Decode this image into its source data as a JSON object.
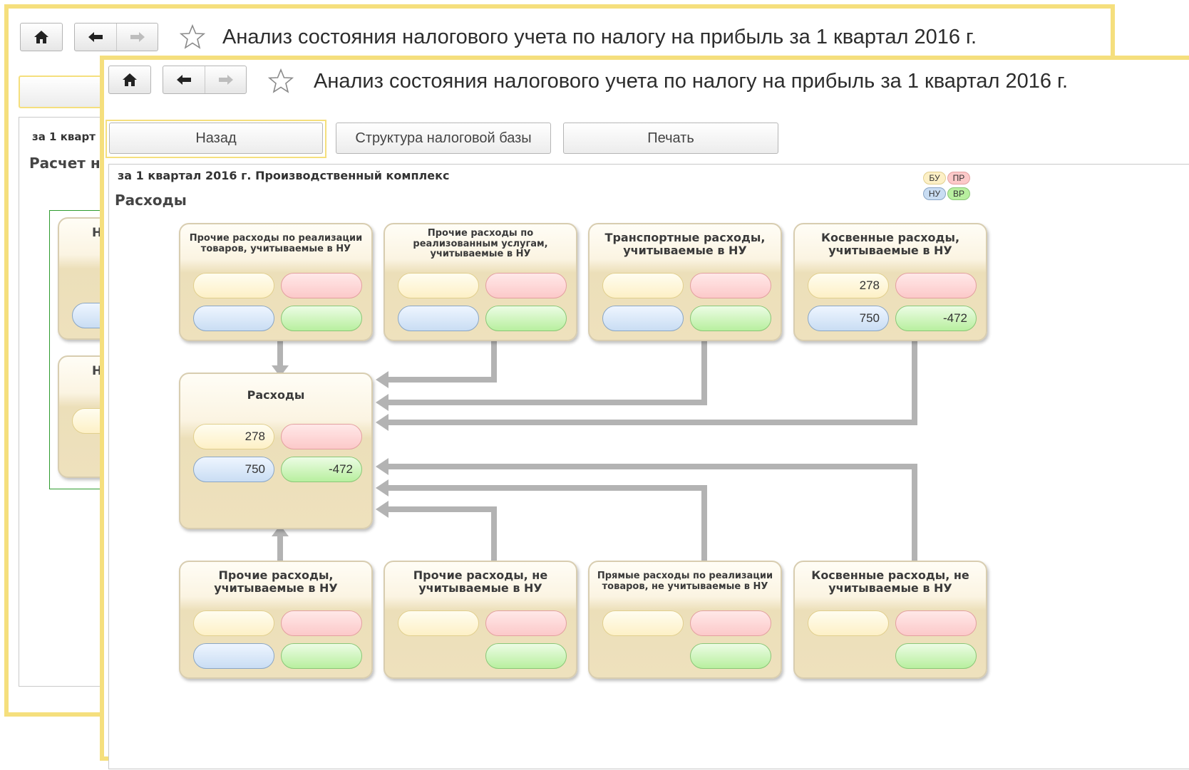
{
  "back_window": {
    "title": "Анализ состояния налогового учета по налогу на прибыль за 1 квартал 2016 г.",
    "period_label": "за 1 кварт",
    "section_title": "Расчет н",
    "card_letters": [
      "Н",
      "Н"
    ]
  },
  "front_window": {
    "title": "Анализ состояния налогового учета по налогу на прибыль за 1 квартал 2016 г.",
    "toolbar": {
      "back_label": "Назад",
      "structure_label": "Структура налоговой базы",
      "print_label": "Печать"
    },
    "report": {
      "header": "за 1 квартал 2016 г. Производственный комплекс",
      "section_title": "Расходы",
      "legend": {
        "bu": "БУ",
        "pr": "ПР",
        "nu": "НУ",
        "vr": "ВР"
      }
    },
    "cards": {
      "top1": {
        "title": "Прочие расходы по реализации товаров, учитываемые в НУ",
        "bu": "",
        "pr": "",
        "nu": "",
        "vr": ""
      },
      "top2": {
        "title": "Прочие расходы по реализованным услугам, учитываемые в НУ",
        "bu": "",
        "pr": "",
        "nu": "",
        "vr": ""
      },
      "top3": {
        "title": "Транспортные расходы, учитываемые в НУ",
        "bu": "",
        "pr": "",
        "nu": "",
        "vr": ""
      },
      "top4": {
        "title": "Косвенные расходы, учитываемые в НУ",
        "bu": "278",
        "pr": "",
        "nu": "750",
        "vr": "-472"
      },
      "center": {
        "title": "Расходы",
        "bu": "278",
        "pr": "",
        "nu": "750",
        "vr": "-472"
      },
      "bot1": {
        "title": "Прочие расходы, учитываемые в НУ",
        "bu": "",
        "pr": "",
        "nu": "",
        "vr": ""
      },
      "bot2": {
        "title": "Прочие расходы, не учитываемые в НУ",
        "bu": "",
        "pr": "",
        "vr": ""
      },
      "bot3": {
        "title": "Прямые расходы по реализации товаров, не учитываемые в НУ",
        "bu": "",
        "pr": "",
        "vr": ""
      },
      "bot4": {
        "title": "Косвенные расходы, не учитываемые в НУ",
        "bu": "",
        "pr": "",
        "vr": ""
      }
    }
  },
  "colors": {
    "window_border": "#f5df7d",
    "pill_bu": "#fdf0c6",
    "pill_pr": "#fcc9c9",
    "pill_nu": "#c9ddf3",
    "pill_vr": "#b8ef9f",
    "arrow": "#b3b3b3"
  },
  "icons": [
    "home-icon",
    "back-arrow-icon",
    "forward-arrow-icon",
    "star-icon"
  ]
}
